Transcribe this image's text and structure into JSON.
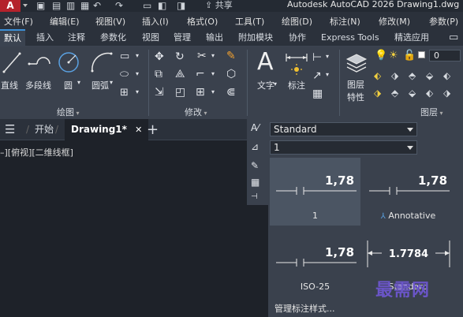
{
  "title": {
    "app_button": "A",
    "share": "共享",
    "app_title": "Autodesk AutoCAD 2026    Drawing1.dwg"
  },
  "menu": [
    "文件(F)",
    "编辑(E)",
    "视图(V)",
    "插入(I)",
    "格式(O)",
    "工具(T)",
    "绘图(D)",
    "标注(N)",
    "修改(M)",
    "参数(P)"
  ],
  "ribbon_tabs": [
    "默认",
    "插入",
    "注释",
    "参数化",
    "视图",
    "管理",
    "输出",
    "附加模块",
    "协作",
    "Express Tools",
    "精选应用"
  ],
  "ribbon": {
    "draw": {
      "line": "直线",
      "polyline": "多段线",
      "circle": "圆",
      "arc": "圆弧",
      "panel": "绘图"
    },
    "modify": {
      "panel": "修改"
    },
    "annotation": {
      "text": "文字",
      "dimension": "标注"
    },
    "layers": {
      "properties_l1": "图层",
      "properties_l2": "特性",
      "panel": "图层",
      "layer_value": "0"
    }
  },
  "file_tabs": {
    "start": "开始",
    "drawing": "Drawing1*",
    "close": "✕",
    "add": "+",
    "menu": "☰"
  },
  "canvas": {
    "viewport_label": "–][俯视][二维线框]"
  },
  "dim_panel": {
    "text_style": "Standard",
    "text_height": "1",
    "tiles": [
      {
        "name": "1",
        "value": "1,78",
        "selected": true,
        "annotative": false
      },
      {
        "name": "Annotative",
        "value": "1,78",
        "selected": false,
        "annotative": true
      },
      {
        "name": "ISO-25",
        "value": "1,78",
        "selected": false,
        "annotative": false
      },
      {
        "name": "Standard",
        "value": "1.7784",
        "selected": false,
        "annotative": false
      }
    ],
    "manage": "管理标注样式..."
  },
  "watermark": "最需网",
  "colors": {
    "accent": "#3c8fd6",
    "app_red": "#b4222b",
    "panel_bg": "#3a414d",
    "canvas_bg": "#1e2229"
  }
}
